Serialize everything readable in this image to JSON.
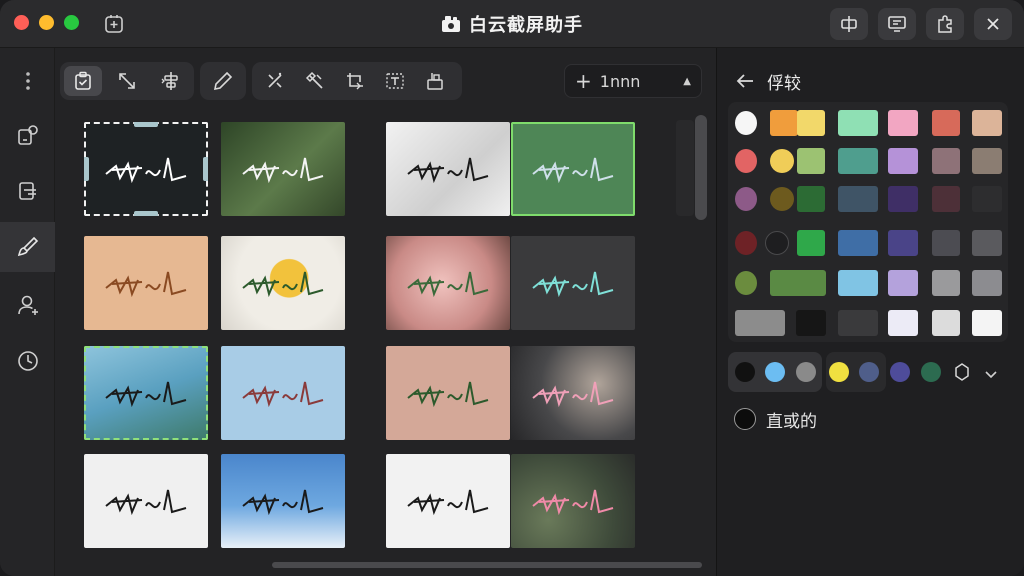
{
  "app": {
    "title": "白云截屏助手"
  },
  "toolbar": {
    "zoom_value": "1nnn"
  },
  "panel": {
    "title": "俘较",
    "option_label": "直或的"
  },
  "swatches": {
    "rows": [
      [
        "#f6f6f6",
        "#f09d3c",
        "#f2d86a",
        "#8fe0b4",
        "#f2a6c2",
        "#d76a5a",
        "#dcb499"
      ],
      [
        "#e26464",
        "#f0cd58",
        "#9cc272",
        "#4f9e8e",
        "#b592d8",
        "#8e7278",
        "#8b7d72"
      ],
      [
        "#8d5a88",
        "#6d5a1e",
        "#2c6b34",
        "#3f5466",
        "#3f2f66",
        "#4d3038",
        "#2d2d2f"
      ],
      [
        "#6e2226",
        "#1e1e20",
        "#2fa84a",
        "#3f6ea6",
        "#4a4488",
        "#4c4c52",
        "#5a5a5e"
      ],
      [
        "#6b8c3e",
        "#5a8a44",
        "#80c4e4",
        "#b4a2dc",
        "#9a9a9c",
        "#8c8c90"
      ],
      [
        "#8c8c8c",
        "#161616",
        "#3a3a3c",
        "#ecebf6",
        "#dcdcdc",
        "#f4f4f4"
      ]
    ],
    "quick": [
      "#111111",
      "#6cbdf2",
      "#8a8a8a",
      "#f0e040",
      "#4f5e8a",
      "#4e4c9a",
      "#2c6b50"
    ]
  }
}
